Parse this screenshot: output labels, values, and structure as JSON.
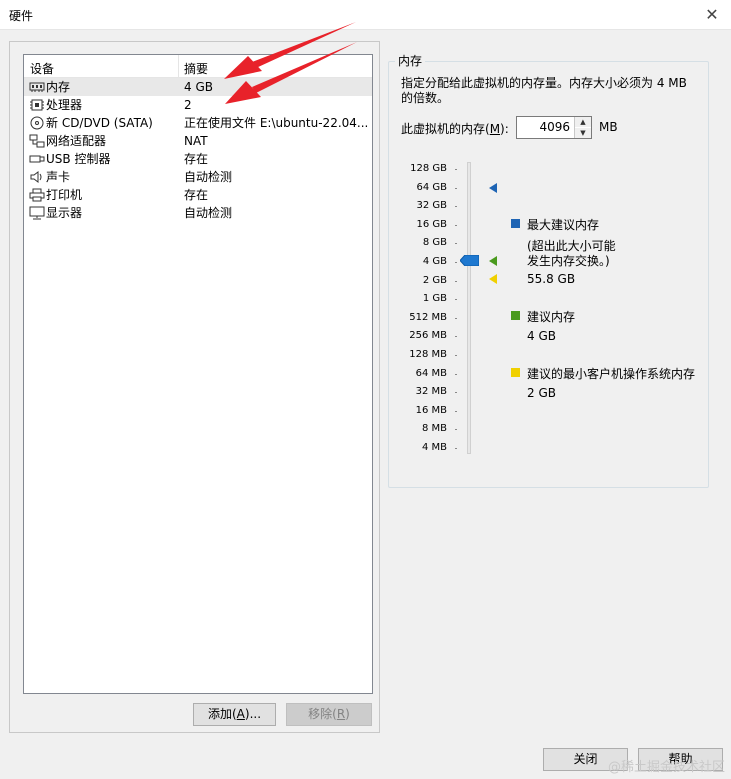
{
  "window": {
    "title": "硬件"
  },
  "device_list": {
    "headers": {
      "device": "设备",
      "summary": "摘要"
    },
    "rows": [
      {
        "name": "内存",
        "summary": "4 GB",
        "icon": "memory-icon"
      },
      {
        "name": "处理器",
        "summary": "2",
        "icon": "cpu-icon"
      },
      {
        "name": "新 CD/DVD (SATA)",
        "summary": "正在使用文件 E:\\ubuntu-22.04...",
        "icon": "cd-dvd-icon"
      },
      {
        "name": "网络适配器",
        "summary": "NAT",
        "icon": "network-icon"
      },
      {
        "name": "USB 控制器",
        "summary": "存在",
        "icon": "usb-icon"
      },
      {
        "name": "声卡",
        "summary": "自动检测",
        "icon": "speaker-icon"
      },
      {
        "name": "打印机",
        "summary": "存在",
        "icon": "printer-icon"
      },
      {
        "name": "显示器",
        "summary": "自动检测",
        "icon": "monitor-icon"
      }
    ],
    "selected_index": 0
  },
  "buttons": {
    "add": {
      "label": "添加(",
      "key": "A",
      "suffix": ")..."
    },
    "remove": {
      "label": "移除(",
      "key": "R",
      "suffix": ")"
    },
    "close": "关闭",
    "help": "帮助"
  },
  "memory": {
    "group_title": "内存",
    "description_line1": "指定分配给此虚拟机的内存量。内存大小必须为 4 MB",
    "description_line2": "的倍数。",
    "field_label_prefix": "此虚拟机的内存(",
    "field_label_key": "M",
    "field_label_suffix": "):",
    "value": "4096",
    "unit": "MB",
    "scale_labels": [
      "128 GB",
      "64 GB",
      "32 GB",
      "16 GB",
      "8 GB",
      "4 GB",
      "2 GB",
      "1 GB",
      "512 MB",
      "256 MB",
      "128 MB",
      "64 MB",
      "32 MB",
      "16 MB",
      "8 MB",
      "4 MB"
    ],
    "legend": {
      "max": {
        "title": "最大建议内存",
        "note1": "(超出此大小可能",
        "note2": "发生内存交换。)",
        "value": "55.8 GB",
        "color": "#1e64b4"
      },
      "recommended": {
        "title": "建议内存",
        "value": "4 GB",
        "color": "#4a9a1e"
      },
      "min_guest": {
        "title": "建议的最小客户机操作系统内存",
        "value": "2 GB",
        "color": "#f0d000"
      }
    }
  },
  "colors": {
    "arrow": "#e8222a"
  },
  "watermark": "@稀土掘金技术社区"
}
